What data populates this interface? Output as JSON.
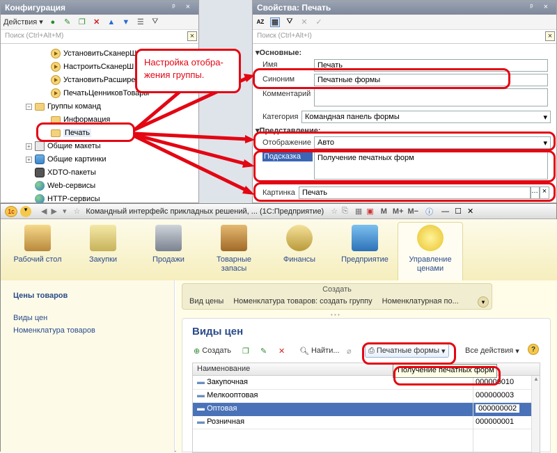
{
  "config_panel": {
    "title": "Конфигурация",
    "actions_label": "Действия",
    "search_placeholder": "Поиск (Ctrl+Alt+M)",
    "tree": [
      {
        "label": "УстановитьСканерШ",
        "icon": "play-icon"
      },
      {
        "label": "НастроитьСканерШ",
        "icon": "play-icon"
      },
      {
        "label": "УстановитьРасшире",
        "icon": "play-icon"
      },
      {
        "label": "ПечатьЦенниковТовары",
        "icon": "play-icon"
      },
      {
        "label": "Группы команд",
        "icon": "folder-icon"
      },
      {
        "label": "Информация",
        "icon": "folder-icon"
      },
      {
        "label": "Печать",
        "icon": "folder-icon"
      },
      {
        "label": "Общие макеты",
        "icon": "document-icon"
      },
      {
        "label": "Общие картинки",
        "icon": "image-icon"
      },
      {
        "label": "XDTO-пакеты",
        "icon": "xdto-icon"
      },
      {
        "label": "Web-сервисы",
        "icon": "globe-icon"
      },
      {
        "label": "HTTP-сервисы",
        "icon": "globe-icon"
      }
    ]
  },
  "callout_text": "Настройка отобра-жения группы.",
  "props_panel": {
    "title": "Свойства: Печать",
    "search_placeholder": "Поиск (Ctrl+Alt+I)",
    "group_main": "Основные:",
    "name_label": "Имя",
    "name_value": "Печать",
    "synonym_label": "Синоним",
    "synonym_value": "Печатные формы",
    "comment_label": "Комментарий",
    "category_label": "Категория",
    "category_value": "Командная панель формы",
    "group_view": "Представление:",
    "display_label": "Отображение",
    "display_value": "Авто",
    "tooltip_label": "Подсказка",
    "tooltip_value": "Получение печатных форм",
    "picture_label": "Картинка",
    "picture_value": "Печать"
  },
  "app": {
    "window_title": "Командный интерфейс прикладных решений, ...  (1С:Предприятие)",
    "title_buttons": [
      "M",
      "M+",
      "M−"
    ],
    "sections": [
      {
        "label": "Рабочий стол",
        "icon": "desk-icon"
      },
      {
        "label": "Закупки",
        "icon": "bag-icon"
      },
      {
        "label": "Продажи",
        "icon": "cash-register-icon"
      },
      {
        "label": "Товарные запасы",
        "icon": "box-icon"
      },
      {
        "label": "Финансы",
        "icon": "coins-icon"
      },
      {
        "label": "Предприятие",
        "icon": "building-icon"
      },
      {
        "label": "Управление ценами",
        "icon": "price-icon"
      }
    ],
    "nav_title": "Цены товаров",
    "nav_links": [
      "Виды цен",
      "Номенклатура товаров"
    ],
    "create_label": "Создать",
    "create_items": [
      "Вид цены",
      "Номенклатура товаров: создать группу",
      "Номенклатурная по..."
    ],
    "form_title": "Виды цен",
    "toolbar": {
      "create": "Создать",
      "find": "Найти...",
      "print_forms": "Печатные формы",
      "all_actions": "Все действия"
    },
    "tooltip_popup": "Получение печатных форм",
    "table_header": "Наименование",
    "rows": [
      {
        "name": "Закупочная",
        "code": "000000010"
      },
      {
        "name": "Мелкооптовая",
        "code": "000000003"
      },
      {
        "name": "Оптовая",
        "code": "000000002"
      },
      {
        "name": "Розничная",
        "code": "000000001"
      }
    ]
  }
}
